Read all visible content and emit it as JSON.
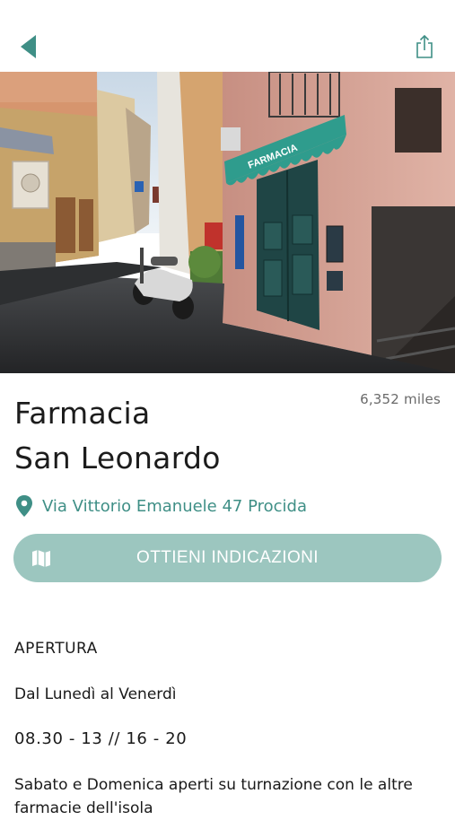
{
  "header": {
    "back_icon": "back-arrow-icon",
    "share_icon": "share-icon",
    "accent_color": "#3f8f86"
  },
  "hero": {
    "sign_text": "FARMACIA"
  },
  "pharmacy": {
    "name_line1": "Farmacia",
    "name_line2": "San Leonardo",
    "distance": "6,352 miles",
    "address": "Via Vittorio Emanuele 47 Procida",
    "address_icon": "map-pin-icon"
  },
  "directions": {
    "label": "OTTIENI INDICAZIONI",
    "icon": "map-icon",
    "bg_color": "#9cc6bf"
  },
  "hours": {
    "heading": "APERTURA",
    "days": "Dal Lunedì al Venerdì",
    "times": "08.30 - 13  //  16 - 20",
    "note": "Sabato e Domenica aperti su turnazione con le altre farmacie dell'isola"
  }
}
